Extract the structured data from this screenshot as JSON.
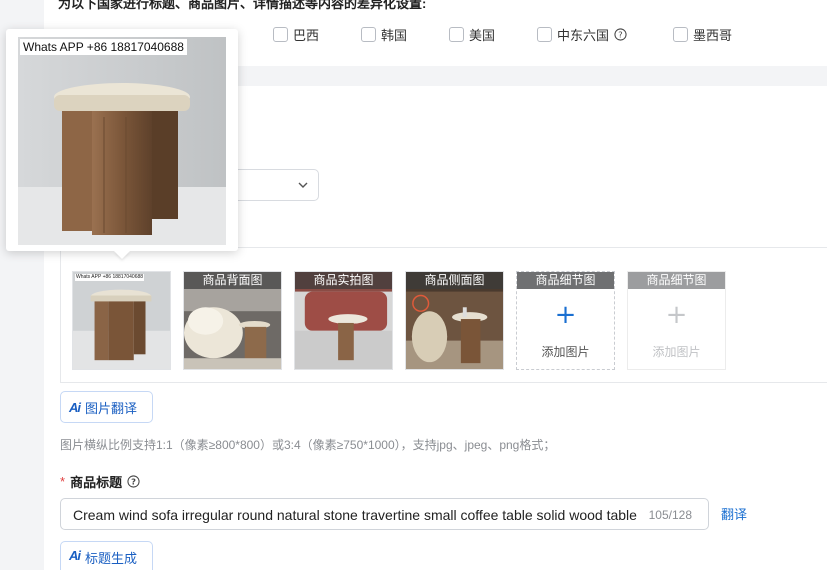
{
  "top": {
    "title": "为以下国家进行标题、商品图片、详情描述等内容的差异化设置:",
    "countries": [
      {
        "label": "巴西",
        "checked": false
      },
      {
        "label": "韩国",
        "checked": false
      },
      {
        "label": "美国",
        "checked": false
      },
      {
        "label": "中东六国",
        "checked": false,
        "help": true
      },
      {
        "label": "墨西哥",
        "checked": false
      }
    ]
  },
  "popup": {
    "watermark": "Whats APP +86 18817040688"
  },
  "images": {
    "slots": [
      {
        "label": "",
        "watermark": "Whats APP +86 18817040688",
        "kind": "photo-main"
      },
      {
        "label": "商品背面图",
        "kind": "photo-sofa"
      },
      {
        "label": "商品实拍图",
        "kind": "photo-red"
      },
      {
        "label": "商品侧面图",
        "kind": "photo-side"
      },
      {
        "label": "商品细节图",
        "kind": "empty",
        "add_text": "添加图片",
        "plus": "+"
      },
      {
        "label": "商品细节图",
        "kind": "disabled",
        "add_text": "添加图片",
        "plus": "+"
      }
    ],
    "translate_button": "图片翻译",
    "ai_badge": "Ai",
    "hint": "图片横纵比例支持1:1（像素≥800*800）或3:4（像素≥750*1000），支持jpg、jpeg、png格式；"
  },
  "product_title": {
    "label": "商品标题",
    "required_mark": "*",
    "value": "Cream wind sofa irregular round natural stone travertine small coffee table solid wood table",
    "count": "105/128",
    "translate_link": "翻译",
    "generate_button": "标题生成"
  },
  "colors": {
    "accent": "#1a6fd1",
    "required": "#e04040"
  }
}
